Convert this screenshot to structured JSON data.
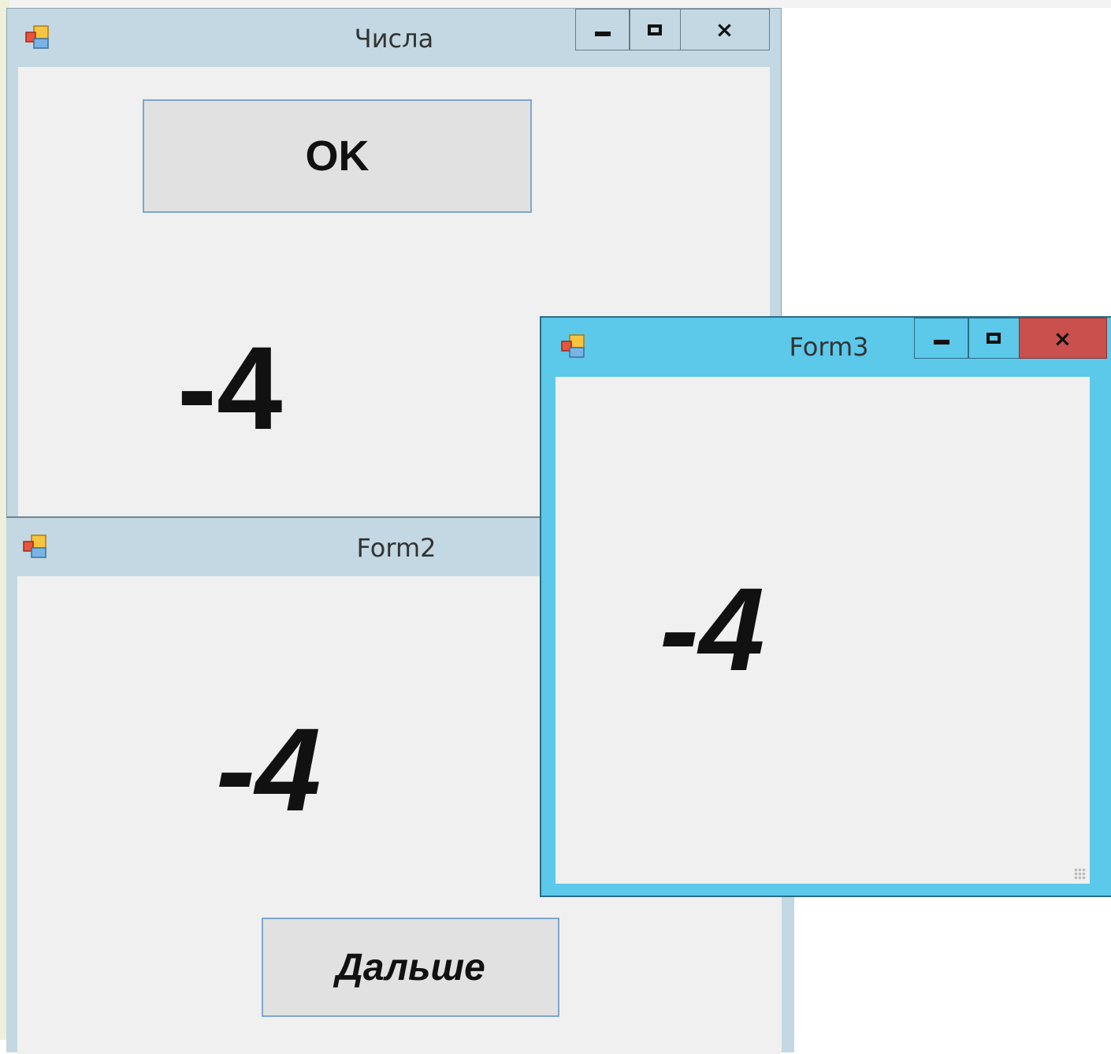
{
  "windows": {
    "main": {
      "title": "Числа",
      "ok_label": "OK",
      "number": "-4",
      "controls": {
        "minimize": "minimize-icon",
        "maximize": "maximize-icon",
        "close": "×"
      }
    },
    "form2": {
      "title": "Form2",
      "number": "-4",
      "next_label": "Дальше"
    },
    "form3": {
      "title": "Form3",
      "number": "-4",
      "controls": {
        "minimize": "minimize-icon",
        "maximize": "maximize-icon",
        "close": "×"
      }
    }
  },
  "colors": {
    "inactive_titlebar": "#c3d8e2",
    "active_titlebar": "#5cc8ea",
    "close_active": "#c9504c",
    "client": "#f0f0f0",
    "button_face": "#e1e1e1",
    "button_border": "#7ea6cf"
  }
}
